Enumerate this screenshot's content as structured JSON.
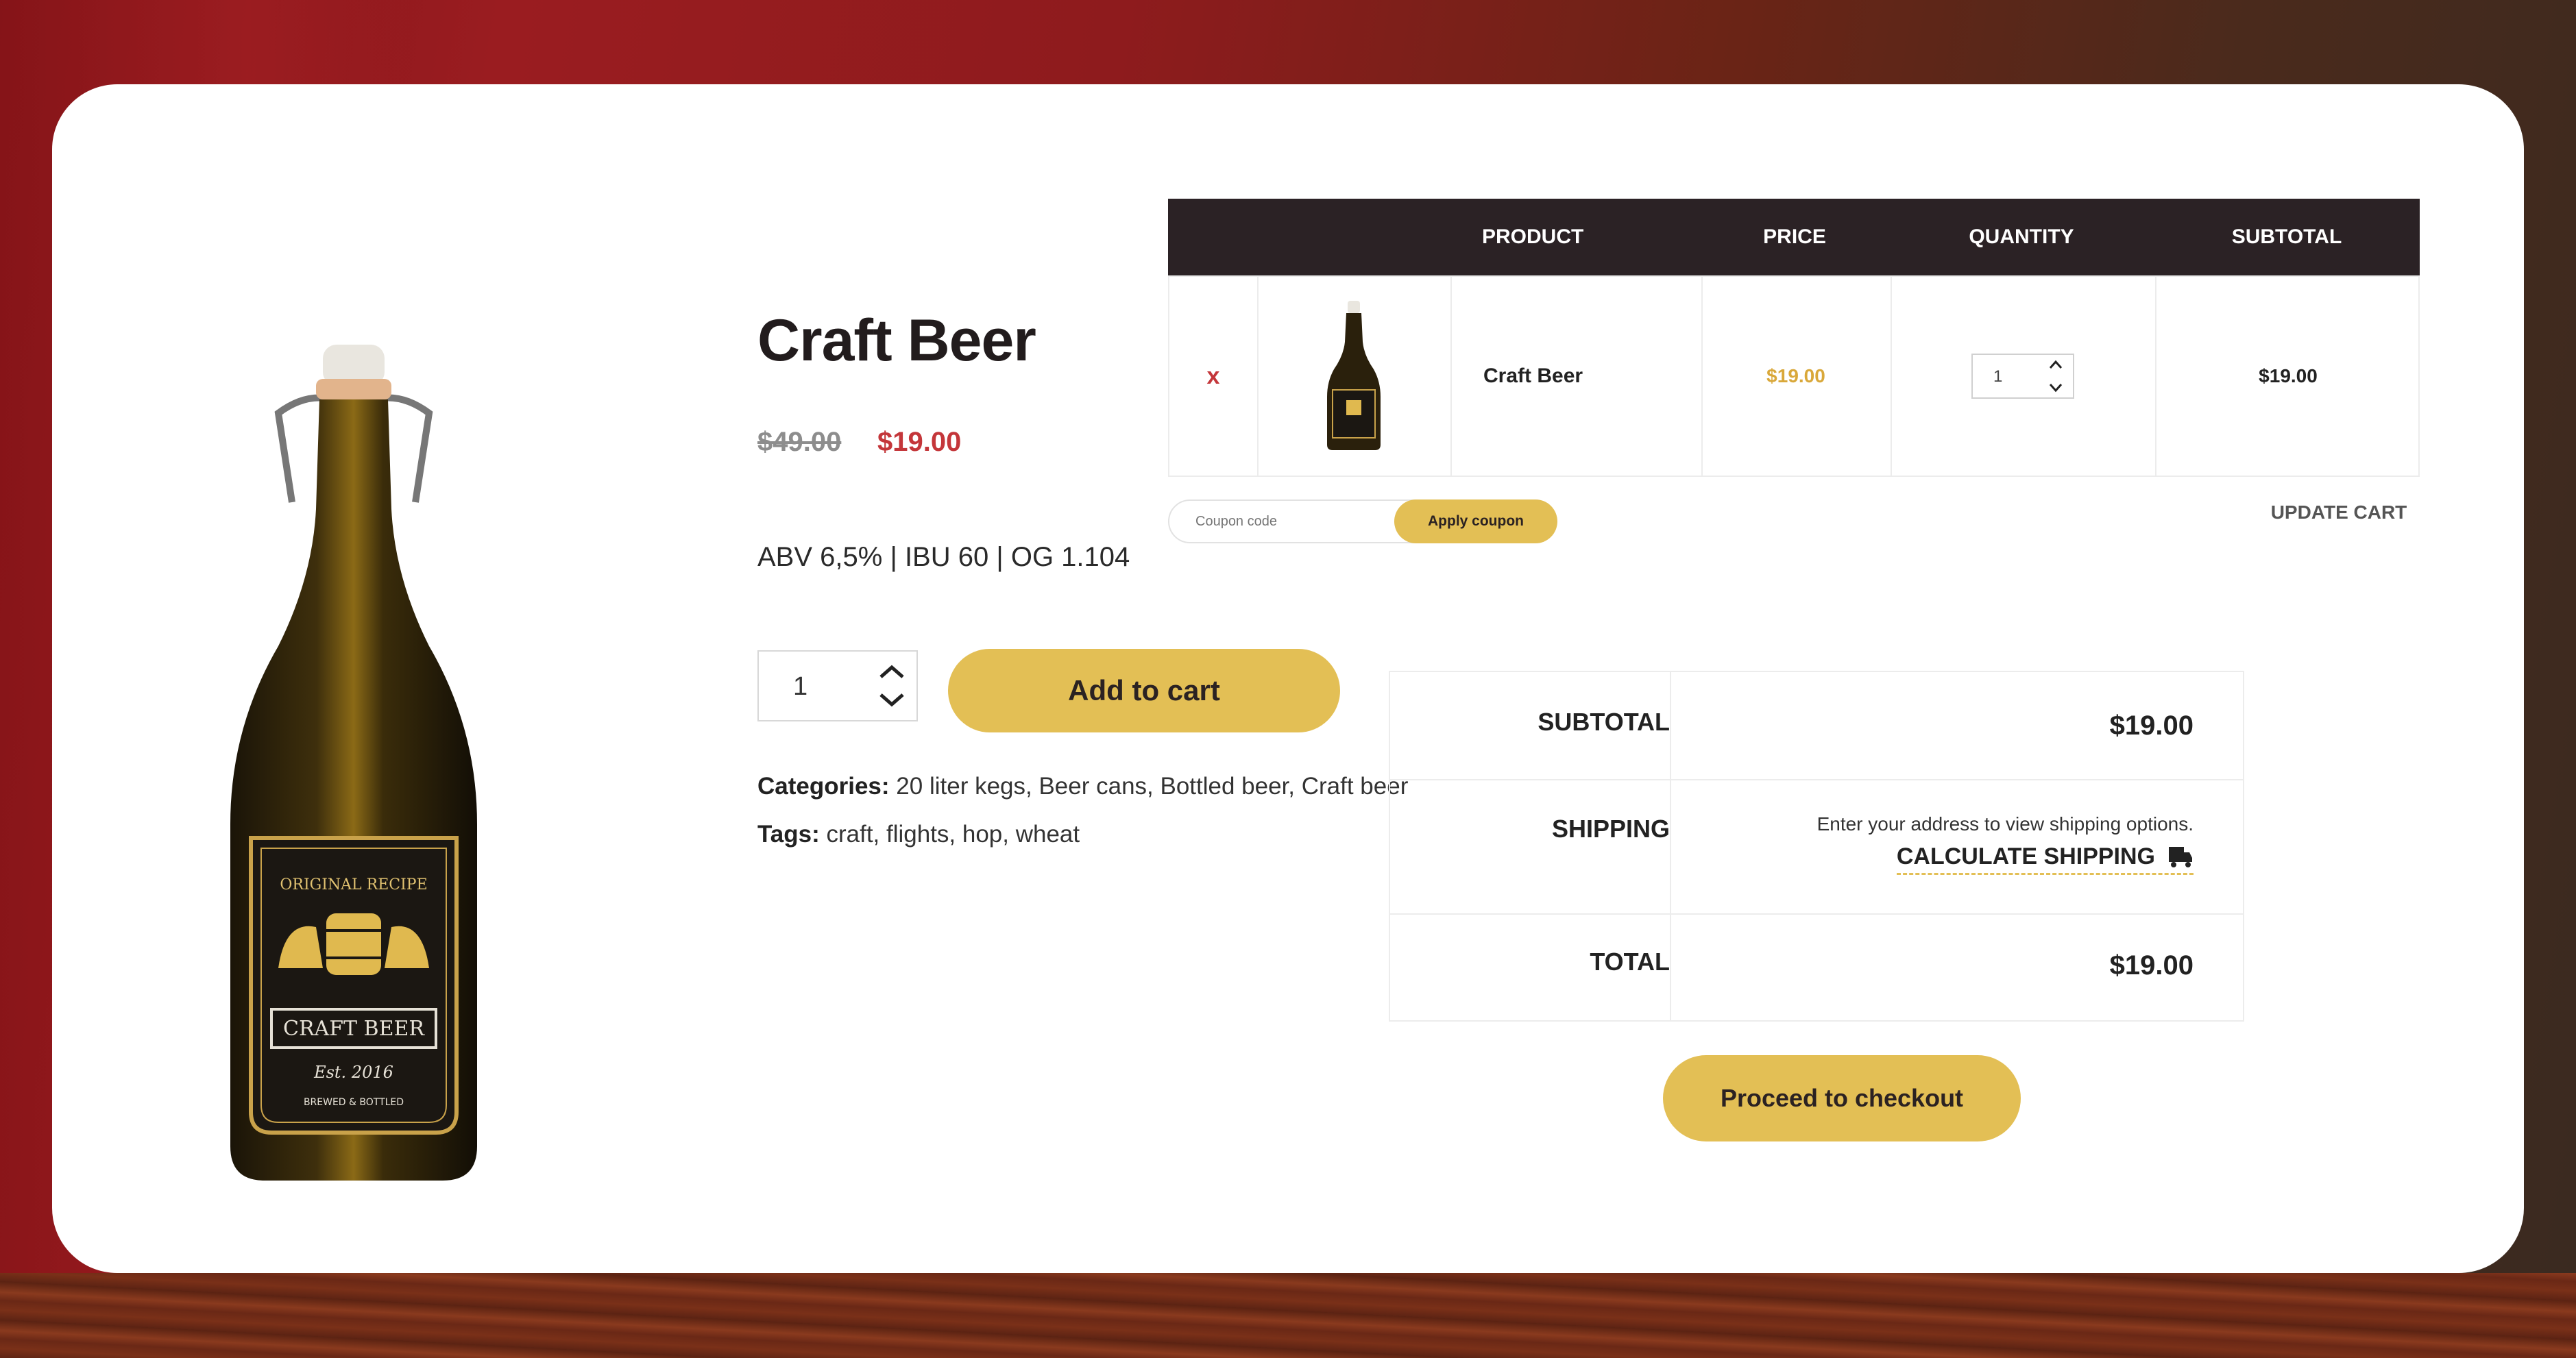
{
  "product": {
    "title": "Craft Beer",
    "price_old": "$49.00",
    "price_new": "$19.00",
    "specs": "ABV 6,5% | IBU 60 | OG 1.104",
    "quantity": "1",
    "add_to_cart_label": "Add to cart",
    "categories_label": "Categories:",
    "categories": "20 liter kegs, Beer cans, Bottled beer, Craft beer",
    "tags_label": "Tags:",
    "tags": "craft, flights, hop, wheat",
    "bottle_label": {
      "top_text": "ORIGINAL RECIPE",
      "banner": "CRAFT BEER",
      "est": "Est. 2016",
      "bottom_text": "BREWED & BOTTLED"
    }
  },
  "cart": {
    "headers": [
      "",
      "",
      "PRODUCT",
      "PRICE",
      "QUANTITY",
      "SUBTOTAL"
    ],
    "items": [
      {
        "remove": "x",
        "name": "Craft Beer",
        "price": "$19.00",
        "quantity": "1",
        "subtotal": "$19.00"
      }
    ],
    "coupon_placeholder": "Coupon code",
    "apply_coupon_label": "Apply coupon",
    "update_cart_label": "UPDATE CART"
  },
  "totals": {
    "subtotal_label": "SUBTOTAL",
    "subtotal_value": "$19.00",
    "shipping_label": "SHIPPING",
    "shipping_note": "Enter your address to view shipping options.",
    "calculate_shipping_label": "CALCULATE SHIPPING",
    "total_label": "TOTAL",
    "total_value": "$19.00",
    "checkout_label": "Proceed to checkout"
  },
  "colors": {
    "accent": "#e3bf55",
    "sale_price": "#c4363a",
    "header_bg": "#2b2225",
    "background": "#9a1c20"
  },
  "icons": {
    "remove": "close-icon",
    "qty_up": "chevron-up-icon",
    "qty_down": "chevron-down-icon",
    "shipping": "truck-icon"
  }
}
